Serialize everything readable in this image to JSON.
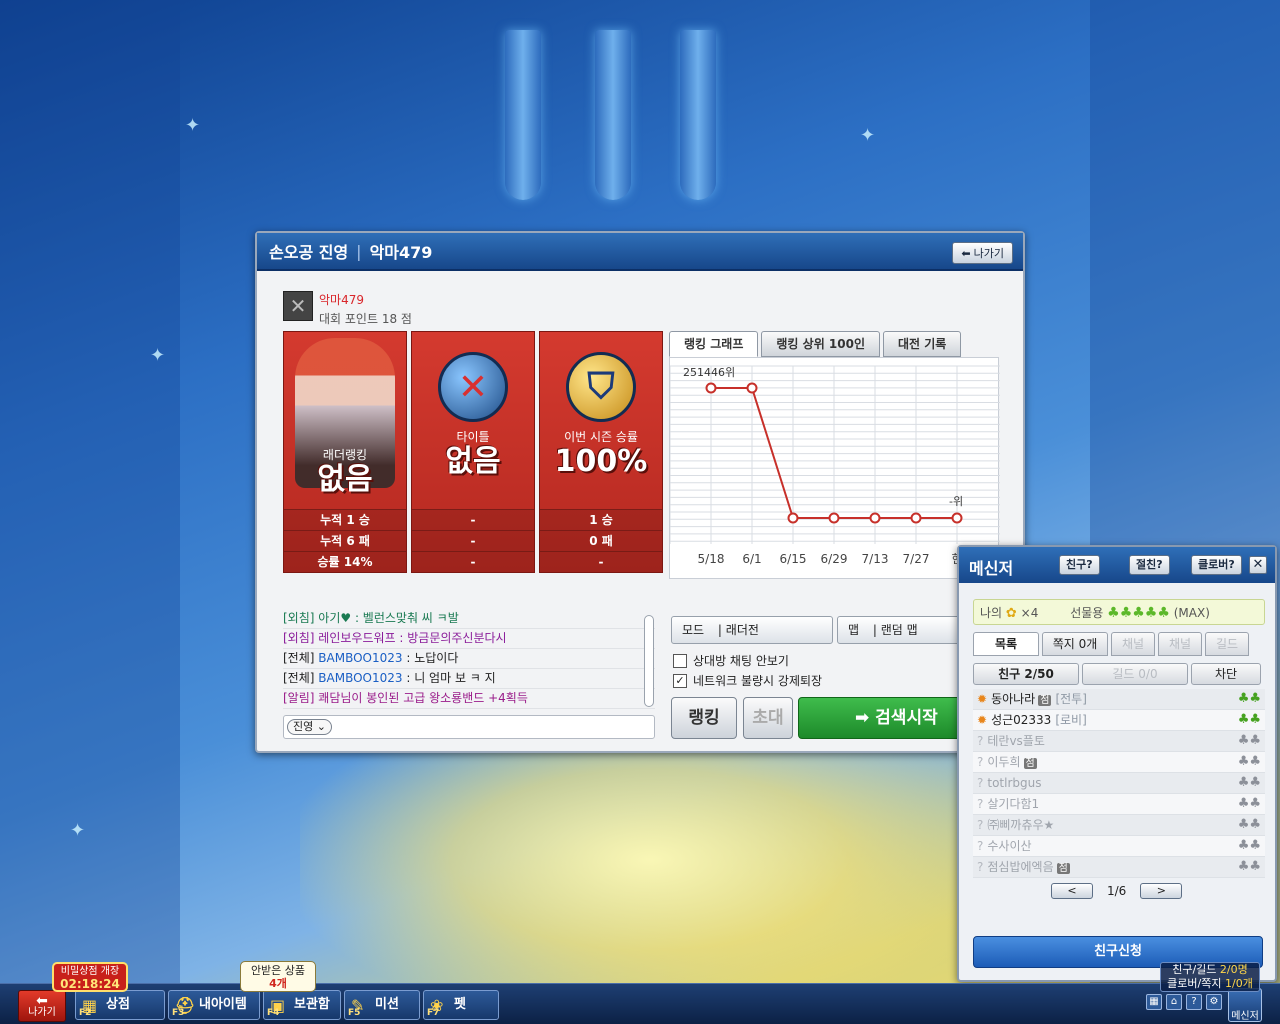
{
  "window": {
    "title_team": "손오공 진영",
    "title_sep": "|",
    "title_player": "악마479",
    "exit_label": "나가기"
  },
  "player": {
    "name": "악마479",
    "points": "대회 포인트 18 점"
  },
  "cards": [
    {
      "label": "래더랭킹",
      "value": "없음",
      "rows": [
        "누적 1 승",
        "누적 6 패",
        "승률 14%"
      ]
    },
    {
      "label": "타이틀",
      "value": "없음",
      "rows": [
        "-",
        "-",
        "-"
      ]
    },
    {
      "label": "이번 시즌 승률",
      "value": "100%",
      "rows": [
        "1 승",
        "0 패",
        "-"
      ]
    }
  ],
  "tabs": [
    "랭킹 그래프",
    "랭킹 상위 100인",
    "대전 기록"
  ],
  "chart_data": {
    "type": "line",
    "categories": [
      "5/18",
      "6/1",
      "6/15",
      "6/29",
      "7/13",
      "7/27",
      "현"
    ],
    "series": [
      {
        "values": [
          251446,
          251446,
          null,
          null,
          null,
          null,
          null
        ]
      }
    ],
    "annotations": [
      {
        "at": "5/18",
        "text": "251446위"
      },
      {
        "at": "현",
        "text": "-위"
      }
    ],
    "point_levels": [
      "high",
      "high",
      "low",
      "low",
      "low",
      "low",
      "low"
    ],
    "grid": true,
    "color": "#c7302a"
  },
  "chat": {
    "lines": [
      {
        "tag": "[외침]",
        "who": "아기♥",
        "msg": " : 벨런스맞춰 씨 ㅋ발",
        "color": "#1a7a52"
      },
      {
        "tag": "[외침]",
        "who": "레인보우드워프",
        "msg": " : 방금문의주신분다시",
        "color": "#8a1c9a"
      },
      {
        "tag": "[전체]",
        "who": "BAMBOO1023",
        "msg": " : 노답이다",
        "color": "#222"
      },
      {
        "tag": "[전체]",
        "who": "BAMBOO1023",
        "msg": " : 니 엄마 보 ㅋ 지",
        "color": "#222"
      },
      {
        "tag": "[알림]",
        "who": "쾌담",
        "msg": "님이 봉인된 고급 왕소룡밴드 +4획득",
        "color": "#9a1c8a"
      }
    ],
    "channel": "진영"
  },
  "settings": {
    "mode_key": "모드",
    "mode_value": "래더전",
    "map_key": "맵",
    "map_value": "랜덤 맵",
    "opt1": "상대방 채팅 안보기",
    "opt1_checked": "",
    "opt2": "네트워크 불량시 강제퇴장",
    "opt2_checked": "✓"
  },
  "actions": {
    "ranking": "랭킹",
    "invite": "초대",
    "search": "검색시작"
  },
  "messenger": {
    "title": "메신저",
    "btn_friend": "친구?",
    "btn_close_friend": "절친?",
    "btn_clover": "클로버?",
    "info_mine": "나의",
    "info_mine_count": "×4",
    "info_gift": "선물용",
    "info_gift_max": "(MAX)",
    "tabs": [
      "목록",
      "쪽지 0개",
      "채널",
      "채널",
      "길드"
    ],
    "subtabs": [
      "친구 2/50",
      "길드 0/0",
      "차단"
    ],
    "friends": [
      {
        "prefix": "✹",
        "name": "동아나라",
        "sub": "[전투]",
        "badge": "점",
        "online": true
      },
      {
        "prefix": "✹",
        "name": "성근02333",
        "sub": "[로비]",
        "badge": "",
        "online": true
      },
      {
        "prefix": "?",
        "name": "테란vs플토",
        "sub": "",
        "badge": "",
        "online": false
      },
      {
        "prefix": "?",
        "name": "이두희",
        "sub": "",
        "badge": "점",
        "online": false
      },
      {
        "prefix": "?",
        "name": "totlrbgus",
        "sub": "",
        "badge": "",
        "online": false
      },
      {
        "prefix": "?",
        "name": "살기다함1",
        "sub": "",
        "badge": "",
        "online": false
      },
      {
        "prefix": "?",
        "name": "㈜삐까츄우★",
        "sub": "",
        "badge": "",
        "online": false
      },
      {
        "prefix": "?",
        "name": "수사이산",
        "sub": "",
        "badge": "",
        "online": false
      },
      {
        "prefix": "?",
        "name": "점심밥에엑음",
        "sub": "",
        "badge": "점",
        "online": false
      }
    ],
    "page": "1/6",
    "prev": "<",
    "next": ">",
    "add_friend": "친구신청"
  },
  "taskbar": {
    "exit": "나가기",
    "secret_shop_title": "비밀상점 개장",
    "secret_shop_time": "02:18:24",
    "stock_text": "안받은 상품",
    "stock_count": "4개",
    "buttons": [
      {
        "key": "F2",
        "label": "상점"
      },
      {
        "key": "F3",
        "label": "내아이템"
      },
      {
        "key": "F4",
        "label": "보관함"
      },
      {
        "key": "F5",
        "label": "미션"
      },
      {
        "key": "F7",
        "label": "펫"
      }
    ],
    "status_line1": "친구/길드",
    "status_value1": "2/0명",
    "status_line2": "클로버/쪽지",
    "status_value2": "1/0개",
    "messenger_label": "메신저"
  }
}
